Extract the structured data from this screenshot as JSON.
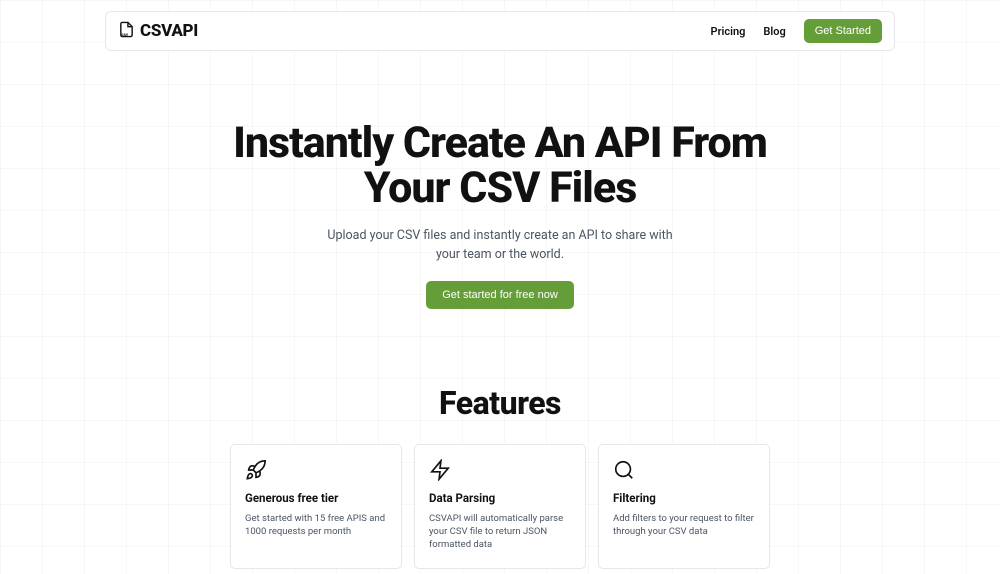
{
  "brand": {
    "name": "CSVAPI"
  },
  "nav": {
    "pricing": "Pricing",
    "blog": "Blog",
    "cta": "Get Started"
  },
  "hero": {
    "title_line1": "Instantly Create An API From",
    "title_line2": "Your CSV Files",
    "subtitle": "Upload your CSV files and instantly create an API to share with your team or the world.",
    "button": "Get started for free now"
  },
  "features": {
    "heading": "Features",
    "items": [
      {
        "title": "Generous free tier",
        "desc": "Get started with 15 free APIS and 1000 requests per month"
      },
      {
        "title": "Data Parsing",
        "desc": "CSVAPI will automatically parse your CSV file to return JSON formatted data"
      },
      {
        "title": "Filtering",
        "desc": "Add filters to your request to filter through your CSV data"
      }
    ]
  }
}
